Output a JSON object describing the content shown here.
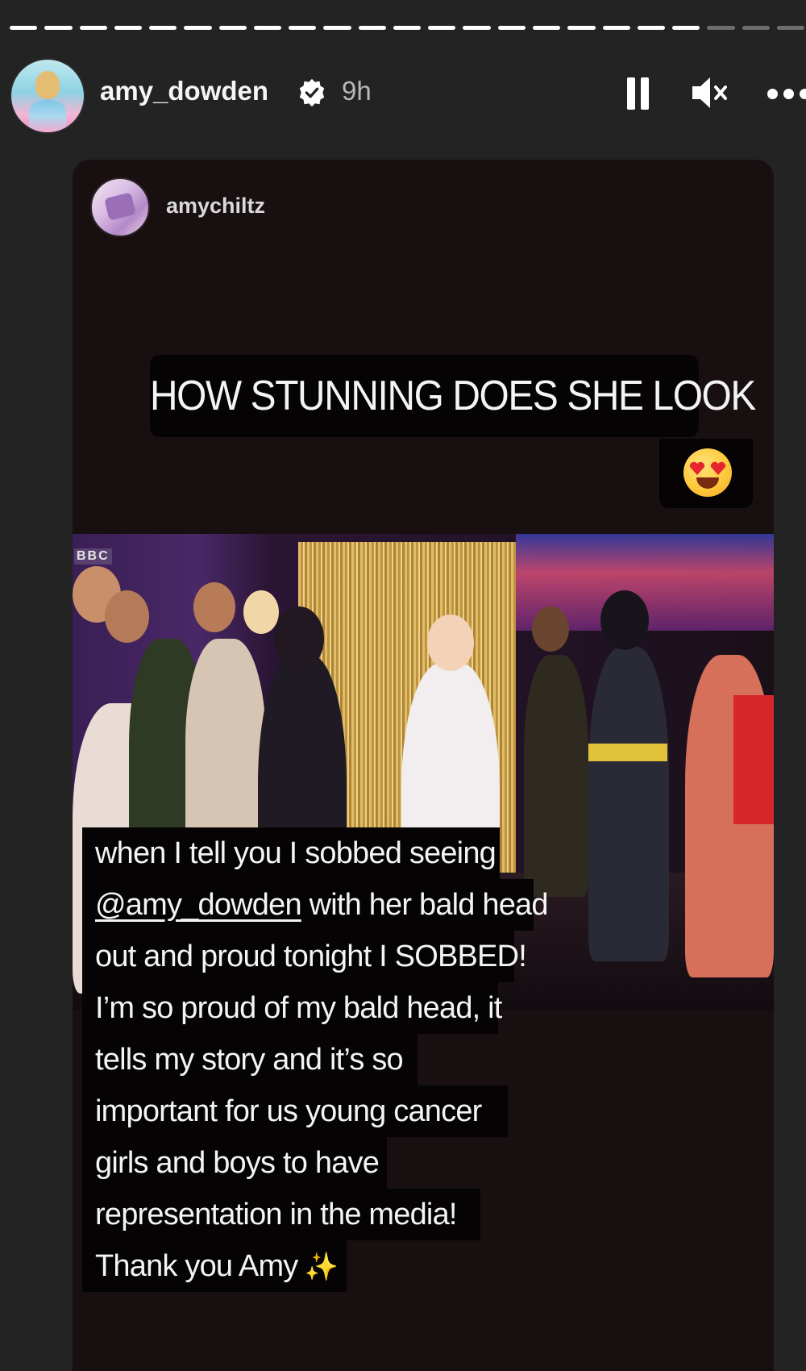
{
  "story": {
    "progress": {
      "segments": 23,
      "viewed": 20
    },
    "header": {
      "username": "amy_dowden",
      "verified": true,
      "time": "9h",
      "controls": [
        "pause-icon",
        "mute-icon",
        "more-icon"
      ]
    },
    "shared_post": {
      "username": "amychiltz",
      "caption_top": "HOW STUNNING DOES SHE LOOK",
      "emoji": "heart-eyes-emoji",
      "photo_watermark": "BBC",
      "caption_lines": [
        "when I tell you I sobbed seeing",
        "with her bald head",
        "out and proud tonight I SOBBED!",
        "I’m so proud of my bald head, it",
        "tells my story and it’s so",
        "important for us young cancer",
        "girls and boys to have",
        "representation in the media!",
        "Thank you Amy"
      ],
      "mention": "@amy_dowden",
      "sparkles": "✨"
    }
  },
  "colors": {
    "background": "#232323",
    "card": "#170f10",
    "caption_bg": "#050304"
  }
}
